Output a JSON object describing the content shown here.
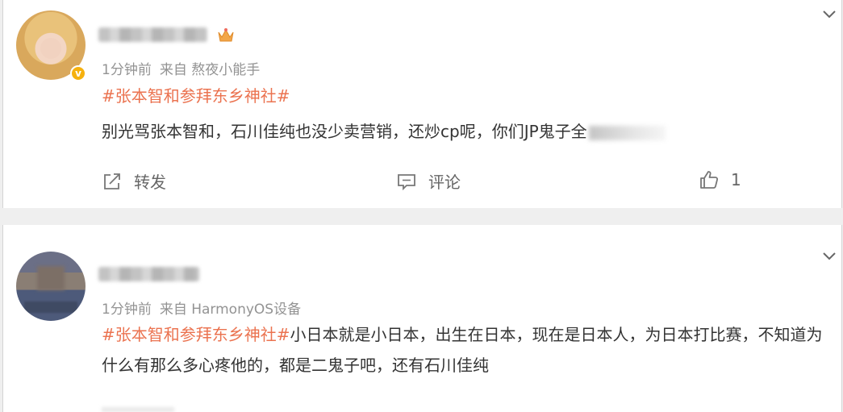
{
  "posts": [
    {
      "time": "1分钟前",
      "source": "来自 熬夜小能手",
      "topic": "#张本智和参拜东乡神社#",
      "text": "别光骂张本智和，石川佳纯也没少卖营销，还炒cp呢，你们JP鬼子全",
      "actions": {
        "repost": "转发",
        "comment": "评论",
        "like_count": "1"
      }
    },
    {
      "time": "1分钟前",
      "source": "来自 HarmonyOS设备",
      "topic": "#张本智和参拜东乡神社#",
      "text": "小日本就是小日本，出生在日本，现在是日本人，为日本打比赛，不知道为什么有那么多心疼他的，都是二鬼子吧，还有石川佳纯"
    }
  ],
  "colors": {
    "topic": "#eb7350",
    "meta": "#939393",
    "verify_badge": "#f6b10e"
  },
  "icons": [
    "chevron-down-icon",
    "verified-icon",
    "crown-icon",
    "repost-icon",
    "comment-icon",
    "like-icon"
  ]
}
